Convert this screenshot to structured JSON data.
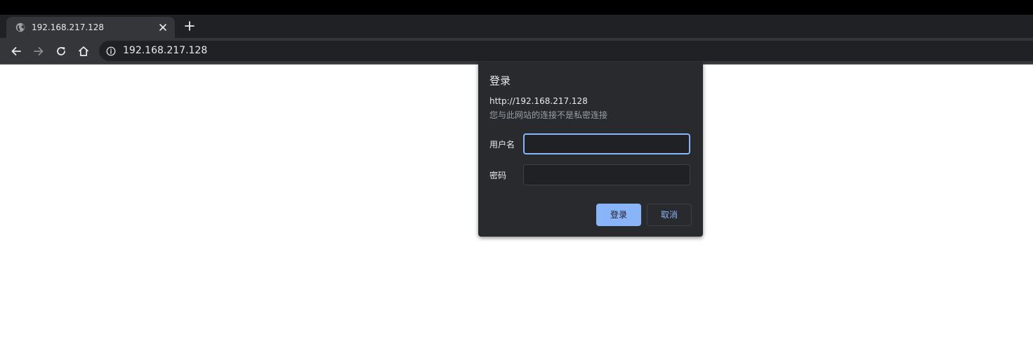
{
  "browser": {
    "tab": {
      "title": "192.168.217.128",
      "favicon": "globe-icon",
      "close_icon": "close-icon"
    },
    "new_tab_icon": "plus-icon",
    "toolbar": {
      "back_icon": "back-arrow-icon",
      "forward_icon": "forward-arrow-icon",
      "reload_icon": "reload-icon",
      "home_icon": "home-icon",
      "site_info_icon": "info-icon",
      "url": "192.168.217.128"
    }
  },
  "auth_dialog": {
    "title": "登录",
    "origin": "http://192.168.217.128",
    "warning": "您与此网站的连接不是私密连接",
    "username_label": "用户名",
    "username_value": "",
    "password_label": "密码",
    "password_value": "",
    "login_label": "登录",
    "cancel_label": "取消"
  },
  "colors": {
    "accent": "#8ab4f8",
    "dialog_bg": "#292a2d",
    "toolbar_bg": "#35363a",
    "tabstrip_bg": "#202124"
  }
}
